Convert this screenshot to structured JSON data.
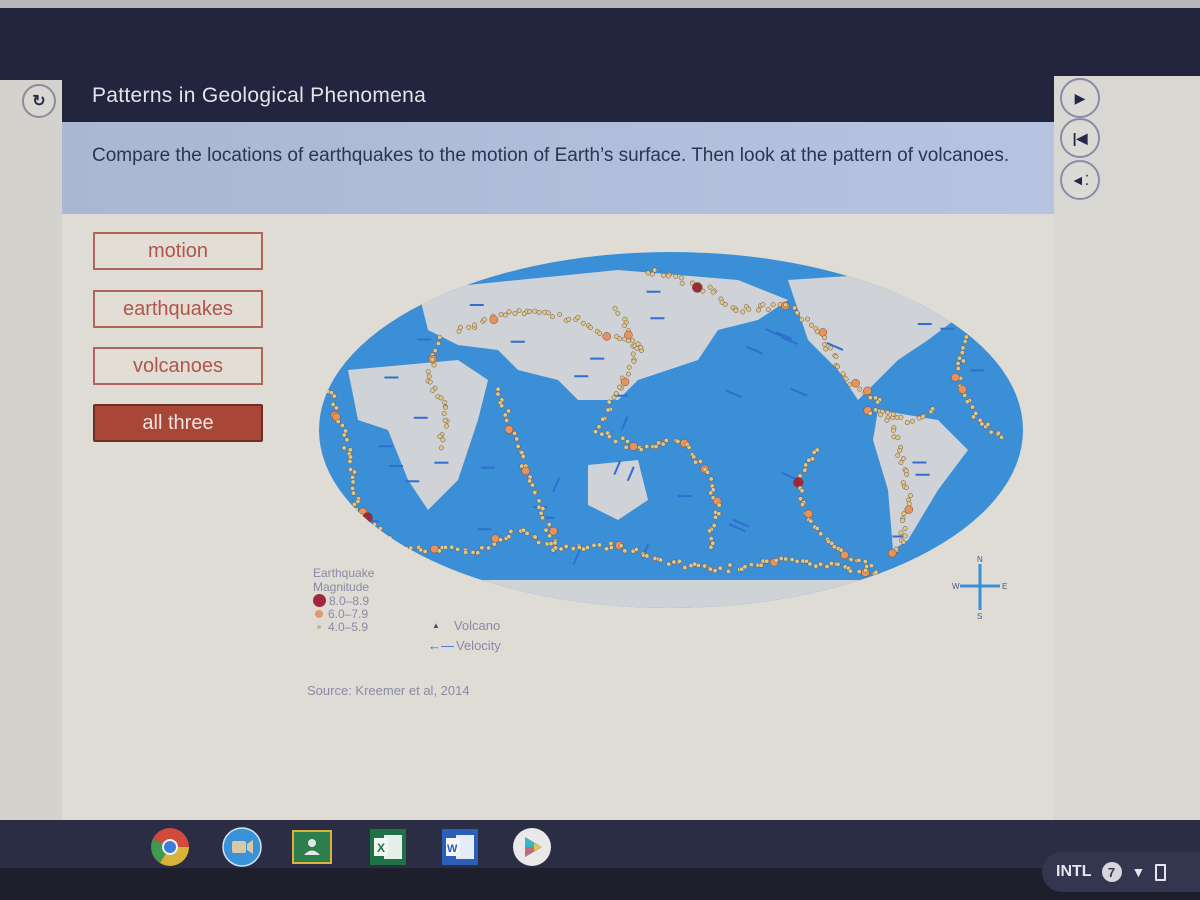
{
  "lesson": {
    "title": "Patterns in Geological Phenomena",
    "instruction": "Compare the locations of earthquakes to the motion of Earth’s surface. Then look at the pattern of volcanoes."
  },
  "options": [
    {
      "label": "motion",
      "selected": false
    },
    {
      "label": "earthquakes",
      "selected": false
    },
    {
      "label": "volcanoes",
      "selected": false
    },
    {
      "label": "all three",
      "selected": true
    }
  ],
  "side_controls": [
    {
      "icon": "play-icon",
      "glyph": "▶"
    },
    {
      "icon": "rewind-icon",
      "glyph": "⏮"
    },
    {
      "icon": "audio-icon",
      "glyph": "🔈"
    }
  ],
  "map": {
    "legend": {
      "title_line1": "Earthquake",
      "title_line2": "Magnitude",
      "magnitudes": [
        {
          "label": "8.0–8.9",
          "color": "#a0283e"
        },
        {
          "label": "6.0–7.9",
          "color": "#e39a6a"
        },
        {
          "label": "4.0–5.9",
          "color": "#c9b98a"
        }
      ],
      "volcano_label": "Volcano",
      "velocity_label": "Velocity"
    },
    "compass": {
      "n": "N",
      "s": "S",
      "e": "E",
      "w": "W"
    },
    "source": "Source: Kreemer et al, 2014",
    "colors": {
      "ocean": "#3b8fd6",
      "land": "#cfd2d6",
      "quake_small": "#d8c98e",
      "quake_mid": "#e8935a",
      "quake_large": "#9a2a38",
      "volcano": "#8a3a3a",
      "arrow": "#2f6fd0"
    }
  },
  "shelf": {
    "apps": [
      {
        "name": "chrome",
        "icon": "chrome-icon"
      },
      {
        "name": "zoom",
        "icon": "video-camera-icon"
      },
      {
        "name": "google classroom",
        "icon": "classroom-icon"
      },
      {
        "name": "excel",
        "icon": "excel-icon",
        "glyph": "X"
      },
      {
        "name": "word",
        "icon": "word-icon",
        "glyph": "W"
      },
      {
        "name": "play store",
        "icon": "play-store-icon"
      }
    ],
    "tray": {
      "ime": "INTL",
      "notifications": "7"
    }
  }
}
